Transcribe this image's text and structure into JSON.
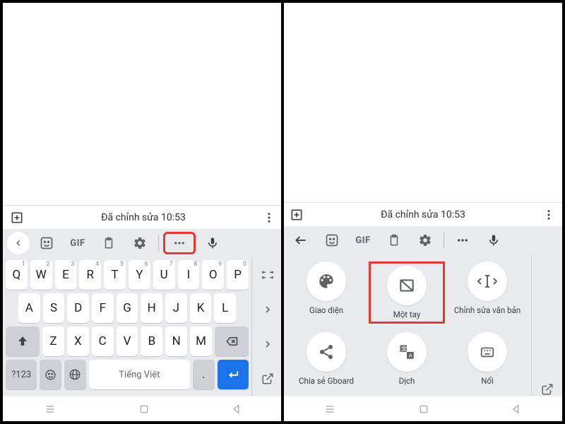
{
  "status": {
    "edited_label": "Đã chỉnh sửa 10:53"
  },
  "toolbar": {
    "gif_label": "GIF",
    "more_icon": "more-icon",
    "mic_icon": "mic-icon"
  },
  "keyboard": {
    "row1": [
      {
        "ch": "Q",
        "sup": "1"
      },
      {
        "ch": "W",
        "sup": "2"
      },
      {
        "ch": "E",
        "sup": "3"
      },
      {
        "ch": "R",
        "sup": "4"
      },
      {
        "ch": "T",
        "sup": "5"
      },
      {
        "ch": "Y",
        "sup": "6"
      },
      {
        "ch": "U",
        "sup": "7"
      },
      {
        "ch": "I",
        "sup": "8"
      },
      {
        "ch": "O",
        "sup": "9"
      },
      {
        "ch": "P",
        "sup": "0"
      }
    ],
    "row2": [
      {
        "ch": "A"
      },
      {
        "ch": "S"
      },
      {
        "ch": "D"
      },
      {
        "ch": "F"
      },
      {
        "ch": "G"
      },
      {
        "ch": "H"
      },
      {
        "ch": "J"
      },
      {
        "ch": "K"
      },
      {
        "ch": "L"
      }
    ],
    "row3": [
      {
        "ch": "Z"
      },
      {
        "ch": "X"
      },
      {
        "ch": "C"
      },
      {
        "ch": "V"
      },
      {
        "ch": "B"
      },
      {
        "ch": "N"
      },
      {
        "ch": "M"
      }
    ],
    "sym_label": "?123",
    "space_label": "Tiếng Việt",
    "period_label": "."
  },
  "options": {
    "items": [
      {
        "id": "theme",
        "label": "Giao diện",
        "icon": "palette"
      },
      {
        "id": "onehand",
        "label": "Một tay",
        "icon": "onehand",
        "highlight": true
      },
      {
        "id": "textedit",
        "label": "Chỉnh sửa văn bản",
        "icon": "textedit"
      },
      {
        "id": "share",
        "label": "Chia sẻ Gboard",
        "icon": "share"
      },
      {
        "id": "translate",
        "label": "Dịch",
        "icon": "translate"
      },
      {
        "id": "float",
        "label": "Nổi",
        "icon": "float"
      }
    ]
  }
}
